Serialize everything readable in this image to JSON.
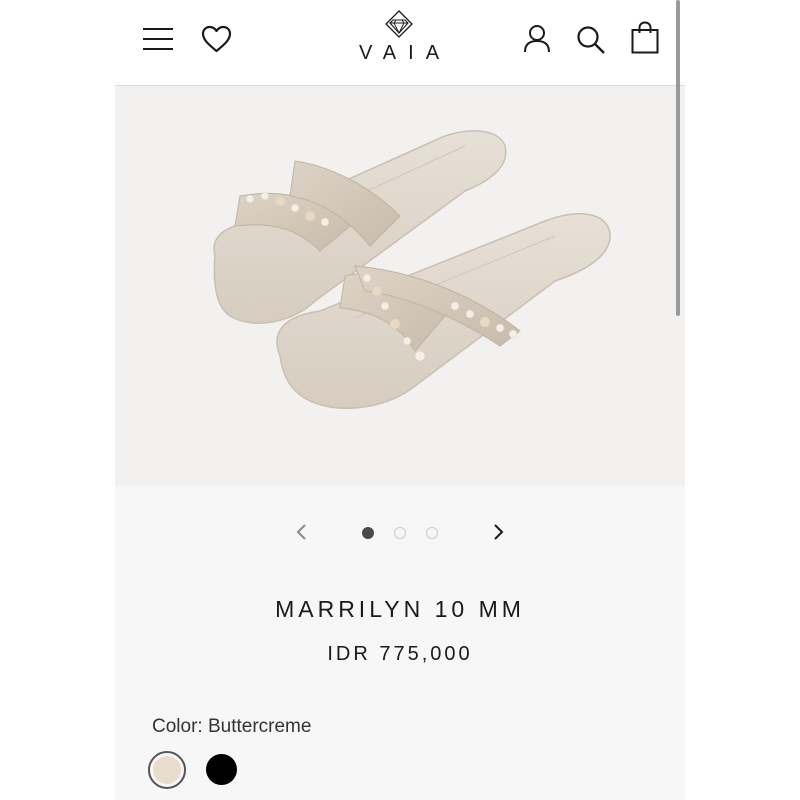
{
  "header": {
    "brand": "VAIA",
    "icons": [
      "menu-icon",
      "heart-icon",
      "logo-diamond-icon",
      "account-icon",
      "search-icon",
      "bag-icon"
    ]
  },
  "gallery": {
    "image_alt": "sandal-product-photo",
    "active_index": 0,
    "dot_count": 3,
    "prev_icon": "chevron-left-icon",
    "next_icon": "chevron-right-icon"
  },
  "product": {
    "name": "MARRILYN 10 MM",
    "price": "IDR 775,000",
    "color_label": "Color: Buttercreme",
    "swatches": [
      {
        "name": "Buttercreme",
        "hex": "#e8dccd",
        "selected": true
      },
      {
        "name": "Black",
        "hex": "#000000",
        "selected": false
      }
    ]
  },
  "colors": {
    "accent": "#1a1a1a",
    "page_bg": "#f7f7f7",
    "hero_bg": "#f2f1ef"
  }
}
